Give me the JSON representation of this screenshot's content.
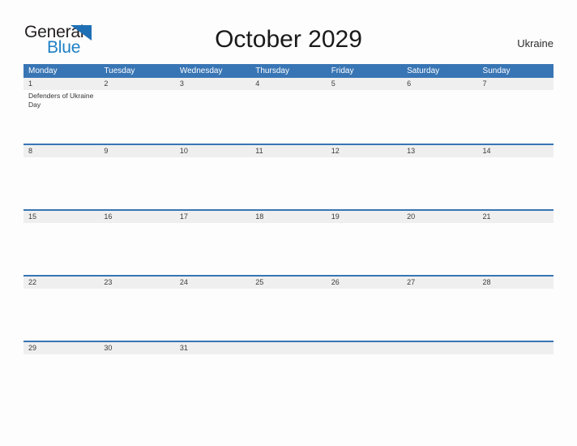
{
  "brand": {
    "name_dark": "General",
    "name_blue": "Blue",
    "flag_icon": "blue-triangle-flag-icon",
    "dark_color": "#231f20",
    "blue_color": "#1f7fc4"
  },
  "header": {
    "title": "October 2029",
    "country": "Ukraine"
  },
  "theme": {
    "header_blue": "#3875b4",
    "band_gray": "#efefef",
    "page_background": "#fdfdfd",
    "text_color": "#3a3a3a"
  },
  "calendar": {
    "month": "October",
    "year": "2029",
    "week_start": "Monday",
    "weekdays": [
      "Monday",
      "Tuesday",
      "Wednesday",
      "Thursday",
      "Friday",
      "Saturday",
      "Sunday"
    ],
    "weeks": [
      [
        {
          "day": "1",
          "events": [
            "Defenders of Ukraine Day"
          ]
        },
        {
          "day": "2",
          "events": []
        },
        {
          "day": "3",
          "events": []
        },
        {
          "day": "4",
          "events": []
        },
        {
          "day": "5",
          "events": []
        },
        {
          "day": "6",
          "events": []
        },
        {
          "day": "7",
          "events": []
        }
      ],
      [
        {
          "day": "8",
          "events": []
        },
        {
          "day": "9",
          "events": []
        },
        {
          "day": "10",
          "events": []
        },
        {
          "day": "11",
          "events": []
        },
        {
          "day": "12",
          "events": []
        },
        {
          "day": "13",
          "events": []
        },
        {
          "day": "14",
          "events": []
        }
      ],
      [
        {
          "day": "15",
          "events": []
        },
        {
          "day": "16",
          "events": []
        },
        {
          "day": "17",
          "events": []
        },
        {
          "day": "18",
          "events": []
        },
        {
          "day": "19",
          "events": []
        },
        {
          "day": "20",
          "events": []
        },
        {
          "day": "21",
          "events": []
        }
      ],
      [
        {
          "day": "22",
          "events": []
        },
        {
          "day": "23",
          "events": []
        },
        {
          "day": "24",
          "events": []
        },
        {
          "day": "25",
          "events": []
        },
        {
          "day": "26",
          "events": []
        },
        {
          "day": "27",
          "events": []
        },
        {
          "day": "28",
          "events": []
        }
      ],
      [
        {
          "day": "29",
          "events": []
        },
        {
          "day": "30",
          "events": []
        },
        {
          "day": "31",
          "events": []
        },
        {
          "day": "",
          "events": []
        },
        {
          "day": "",
          "events": []
        },
        {
          "day": "",
          "events": []
        },
        {
          "day": "",
          "events": []
        }
      ]
    ]
  }
}
